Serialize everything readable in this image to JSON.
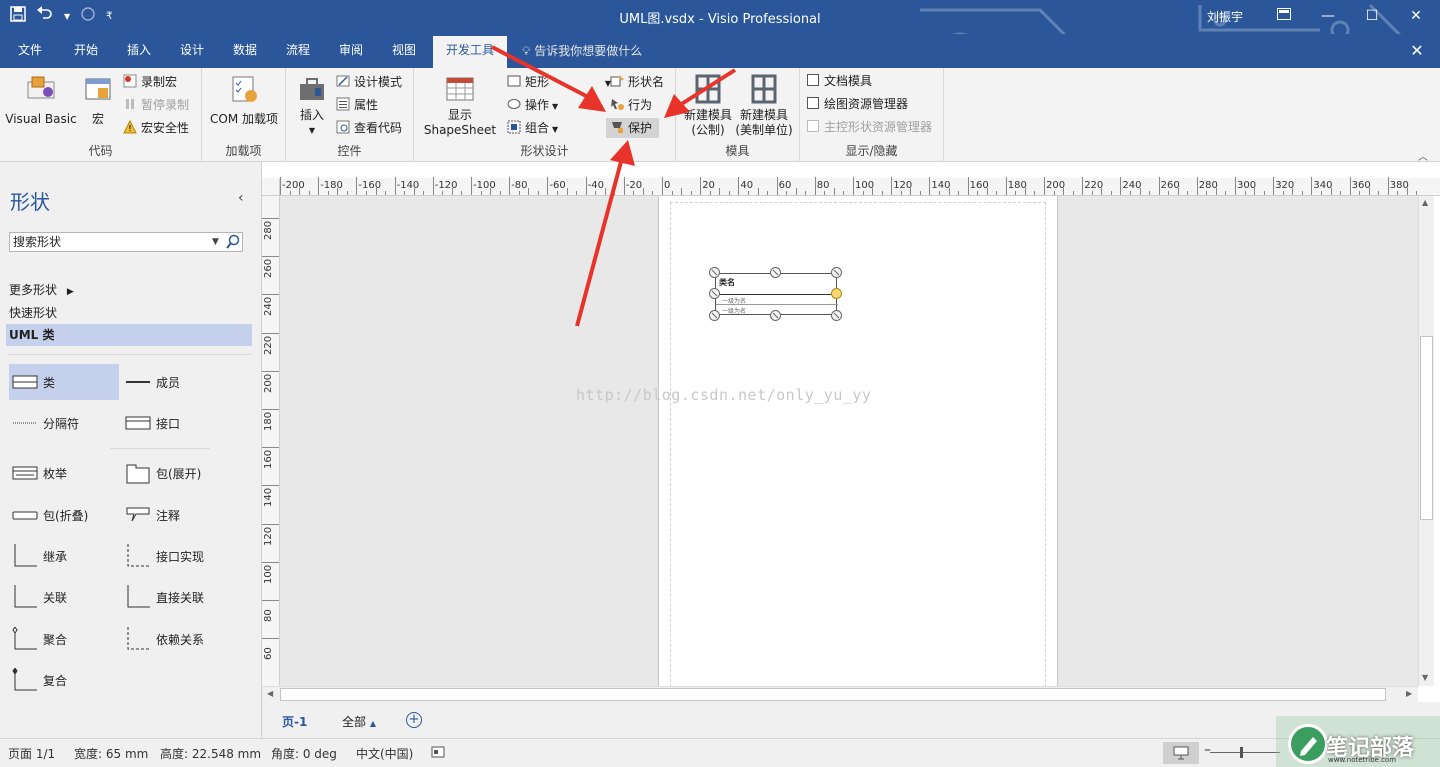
{
  "window": {
    "title": "UML图.vsdx  -  Visio Professional",
    "user": "刘振宇"
  },
  "tabs": [
    {
      "label": "文件"
    },
    {
      "label": "开始"
    },
    {
      "label": "插入"
    },
    {
      "label": "设计"
    },
    {
      "label": "数据"
    },
    {
      "label": "流程"
    },
    {
      "label": "审阅"
    },
    {
      "label": "视图"
    },
    {
      "label": "开发工具"
    }
  ],
  "tellme": "告诉我你想要做什么",
  "ribbon": {
    "code": {
      "label": "代码",
      "visual_basic": "Visual Basic",
      "macros": "宏",
      "record_macro": "录制宏",
      "pause_recording": "暂停录制",
      "macro_security": "宏安全性"
    },
    "addins": {
      "label": "加载项",
      "com_addins": "COM 加载项"
    },
    "controls": {
      "label": "控件",
      "insert": "插入",
      "design_mode": "设计模式",
      "properties": "属性",
      "view_code": "查看代码"
    },
    "shape_design": {
      "label": "形状设计",
      "show_shapesheet_line1": "显示",
      "show_shapesheet_line2": "ShapeSheet",
      "rectangle": "矩形",
      "operations": "操作",
      "group": "组合",
      "shape_name": "形状名",
      "behavior": "行为",
      "protection": "保护"
    },
    "stencil": {
      "label": "模具",
      "new_metric_line1": "新建模具",
      "new_metric_line2": "(公制)",
      "new_us_line1": "新建模具",
      "new_us_line2": "(美制单位)"
    },
    "show_hide": {
      "label": "显示/隐藏",
      "document_stencil": "文档模具",
      "drawing_explorer": "绘图资源管理器",
      "master_explorer": "主控形状资源管理器"
    }
  },
  "shapes_panel": {
    "title": "形状",
    "search_placeholder": "搜索形状",
    "more_shapes": "更多形状",
    "quick_shapes": "快速形状",
    "current_stencil": "UML 类",
    "items": [
      {
        "label": "类"
      },
      {
        "label": "成员"
      },
      {
        "label": "分隔符"
      },
      {
        "label": "接口"
      },
      {
        "label": "枚举"
      },
      {
        "label": "包(展开)"
      },
      {
        "label": "包(折叠)"
      },
      {
        "label": "注释"
      },
      {
        "label": "继承"
      },
      {
        "label": "接口实现"
      },
      {
        "label": "关联"
      },
      {
        "label": "直接关联"
      },
      {
        "label": "聚合"
      },
      {
        "label": "依赖关系"
      },
      {
        "label": "复合"
      }
    ]
  },
  "hruler_labels": [
    "-200",
    "-180",
    "-160",
    "-140",
    "-120",
    "-100",
    "-80",
    "-60",
    "-40",
    "-20",
    "0",
    "20",
    "40",
    "60",
    "80",
    "100",
    "120",
    "140",
    "160",
    "180",
    "200",
    "220",
    "240",
    "260",
    "280",
    "300",
    "320",
    "340",
    "360",
    "380"
  ],
  "vruler_labels": [
    "280",
    "260",
    "240",
    "220",
    "200",
    "180",
    "160",
    "140",
    "120",
    "100",
    "80",
    "60"
  ],
  "canvas": {
    "watermark": "http://blog.csdn.net/only_yu_yy",
    "shape": {
      "name": "类名",
      "attr1": "一级为名",
      "attr2": "一级为名"
    }
  },
  "page_tabs": {
    "current": "页-1",
    "all": "全部",
    "all_arrow": "▲"
  },
  "status": {
    "page": "页面 1/1",
    "width": "宽度: 65 mm",
    "height": "高度: 22.548 mm",
    "angle": "角度: 0 deg",
    "language": "中文(中国)"
  },
  "logo": {
    "text": "笔记部落",
    "url": "www.notetribe.com"
  },
  "colors": {
    "accent": "#2b579a",
    "annotation_arrow": "#e8332b"
  }
}
